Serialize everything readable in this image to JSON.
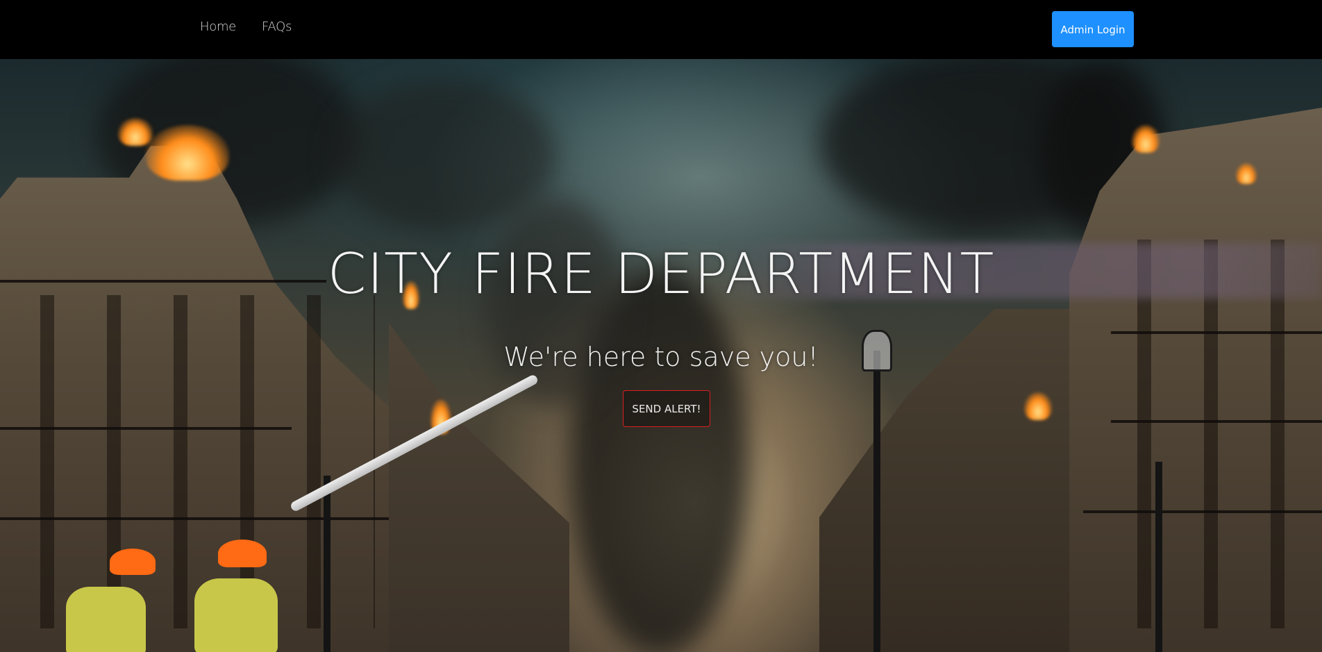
{
  "navbar": {
    "links": [
      {
        "label": "Home"
      },
      {
        "label": "FAQs"
      }
    ],
    "admin_button": "Admin Login"
  },
  "hero": {
    "title": "CITY FIRE DEPARTMENT",
    "subtitle": "We're here to save you!",
    "alert_button": "SEND ALERT!"
  },
  "colors": {
    "navbar_background": "#000000",
    "admin_button": "#1e90ff",
    "alert_button_border": "#d82020",
    "hero_text": "#f4f4f4"
  }
}
